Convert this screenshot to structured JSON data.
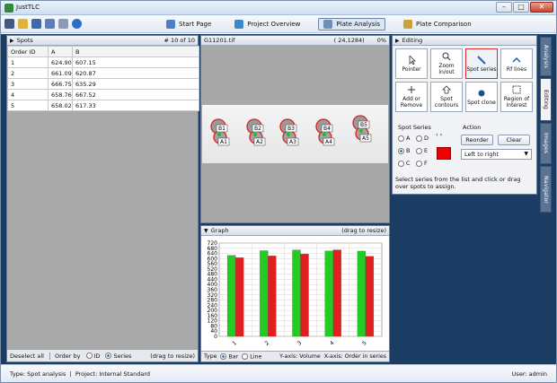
{
  "window": {
    "title": "JustTLC",
    "min": "–",
    "max": "□",
    "close": "✕"
  },
  "toolbar": {
    "icons": [
      "menu-icon",
      "open-icon",
      "save-icon",
      "export-icon",
      "undo-icon",
      "help-icon"
    ],
    "tabs": [
      {
        "label": "Start Page",
        "icon": "home-icon"
      },
      {
        "label": "Project Overview",
        "icon": "overview-icon"
      },
      {
        "label": "Plate Analysis",
        "icon": "analysis-icon",
        "active": true
      },
      {
        "label": "Plate Comparison",
        "icon": "compare-icon"
      }
    ]
  },
  "spots": {
    "title": "Spots",
    "count": "# 10 of 10",
    "columns": [
      "Order ID",
      "A",
      "B"
    ],
    "rows": [
      [
        "1",
        "624.90",
        "607.15"
      ],
      [
        "2",
        "661.09",
        "620.87"
      ],
      [
        "3",
        "666.75",
        "635.29"
      ],
      [
        "4",
        "658.76",
        "667.52"
      ],
      [
        "5",
        "658.02",
        "617.33"
      ]
    ],
    "footer": {
      "deselect": "Deselect all",
      "orderby": "Order by",
      "id": "ID",
      "series": "Series",
      "drag": "(drag to resize)"
    }
  },
  "image": {
    "filename": "G11201.tif",
    "coords": "( 24,1284)",
    "zoom": "0%",
    "spots": [
      {
        "top": "B1",
        "bottom": "A1"
      },
      {
        "top": "B2",
        "bottom": "A2"
      },
      {
        "top": "B3",
        "bottom": "A3"
      },
      {
        "top": "B4",
        "bottom": "A4"
      },
      {
        "top": "B5",
        "bottom": "A5"
      }
    ]
  },
  "graph": {
    "title": "Graph",
    "drag": "(drag to resize)",
    "footer": {
      "type": "Type",
      "bar": "Bar",
      "line": "Line",
      "yaxis": "Y-axis: Volume",
      "xaxis": "X-axis: Order in series"
    }
  },
  "chart_data": {
    "type": "bar",
    "categories": [
      "1",
      "2",
      "3",
      "4",
      "5"
    ],
    "series": [
      {
        "name": "A",
        "color": "#22cc22",
        "values": [
          624.9,
          661.09,
          666.75,
          658.76,
          658.02
        ]
      },
      {
        "name": "B",
        "color": "#e02020",
        "values": [
          607.15,
          620.87,
          635.29,
          667.52,
          617.33
        ]
      }
    ],
    "ylim": [
      0,
      720
    ],
    "yticks": [
      0,
      40,
      80,
      120,
      160,
      200,
      240,
      280,
      320,
      360,
      400,
      440,
      480,
      520,
      560,
      600,
      640,
      680,
      720
    ],
    "grid": true
  },
  "editing": {
    "title": "Editing",
    "tools": [
      {
        "label": "Pointer"
      },
      {
        "label": "Zoom in/out"
      },
      {
        "label": "Spot series",
        "selected": true
      },
      {
        "label": "Rf lines"
      },
      {
        "label": "Add or Remove"
      },
      {
        "label": "Spot contours"
      },
      {
        "label": "Spot clone"
      },
      {
        "label": "Region of interest"
      }
    ],
    "spot_series": "Spot Series",
    "series_options": [
      "A",
      "B",
      "C",
      "D",
      "E",
      "F"
    ],
    "selected_series": "B",
    "action": "Action",
    "reorder": "Reorder",
    "clear": "Clear",
    "direction": "Left to right",
    "color": "#e00000",
    "hint": "Select series from the list and click or drag over spots to assign."
  },
  "sidetabs": [
    "Analysis",
    "Editing",
    "Images",
    "Navigator"
  ],
  "status": {
    "type": "Type:  Spot analysis",
    "project": "Project:  Internal Standard",
    "user": "User:  admin"
  }
}
